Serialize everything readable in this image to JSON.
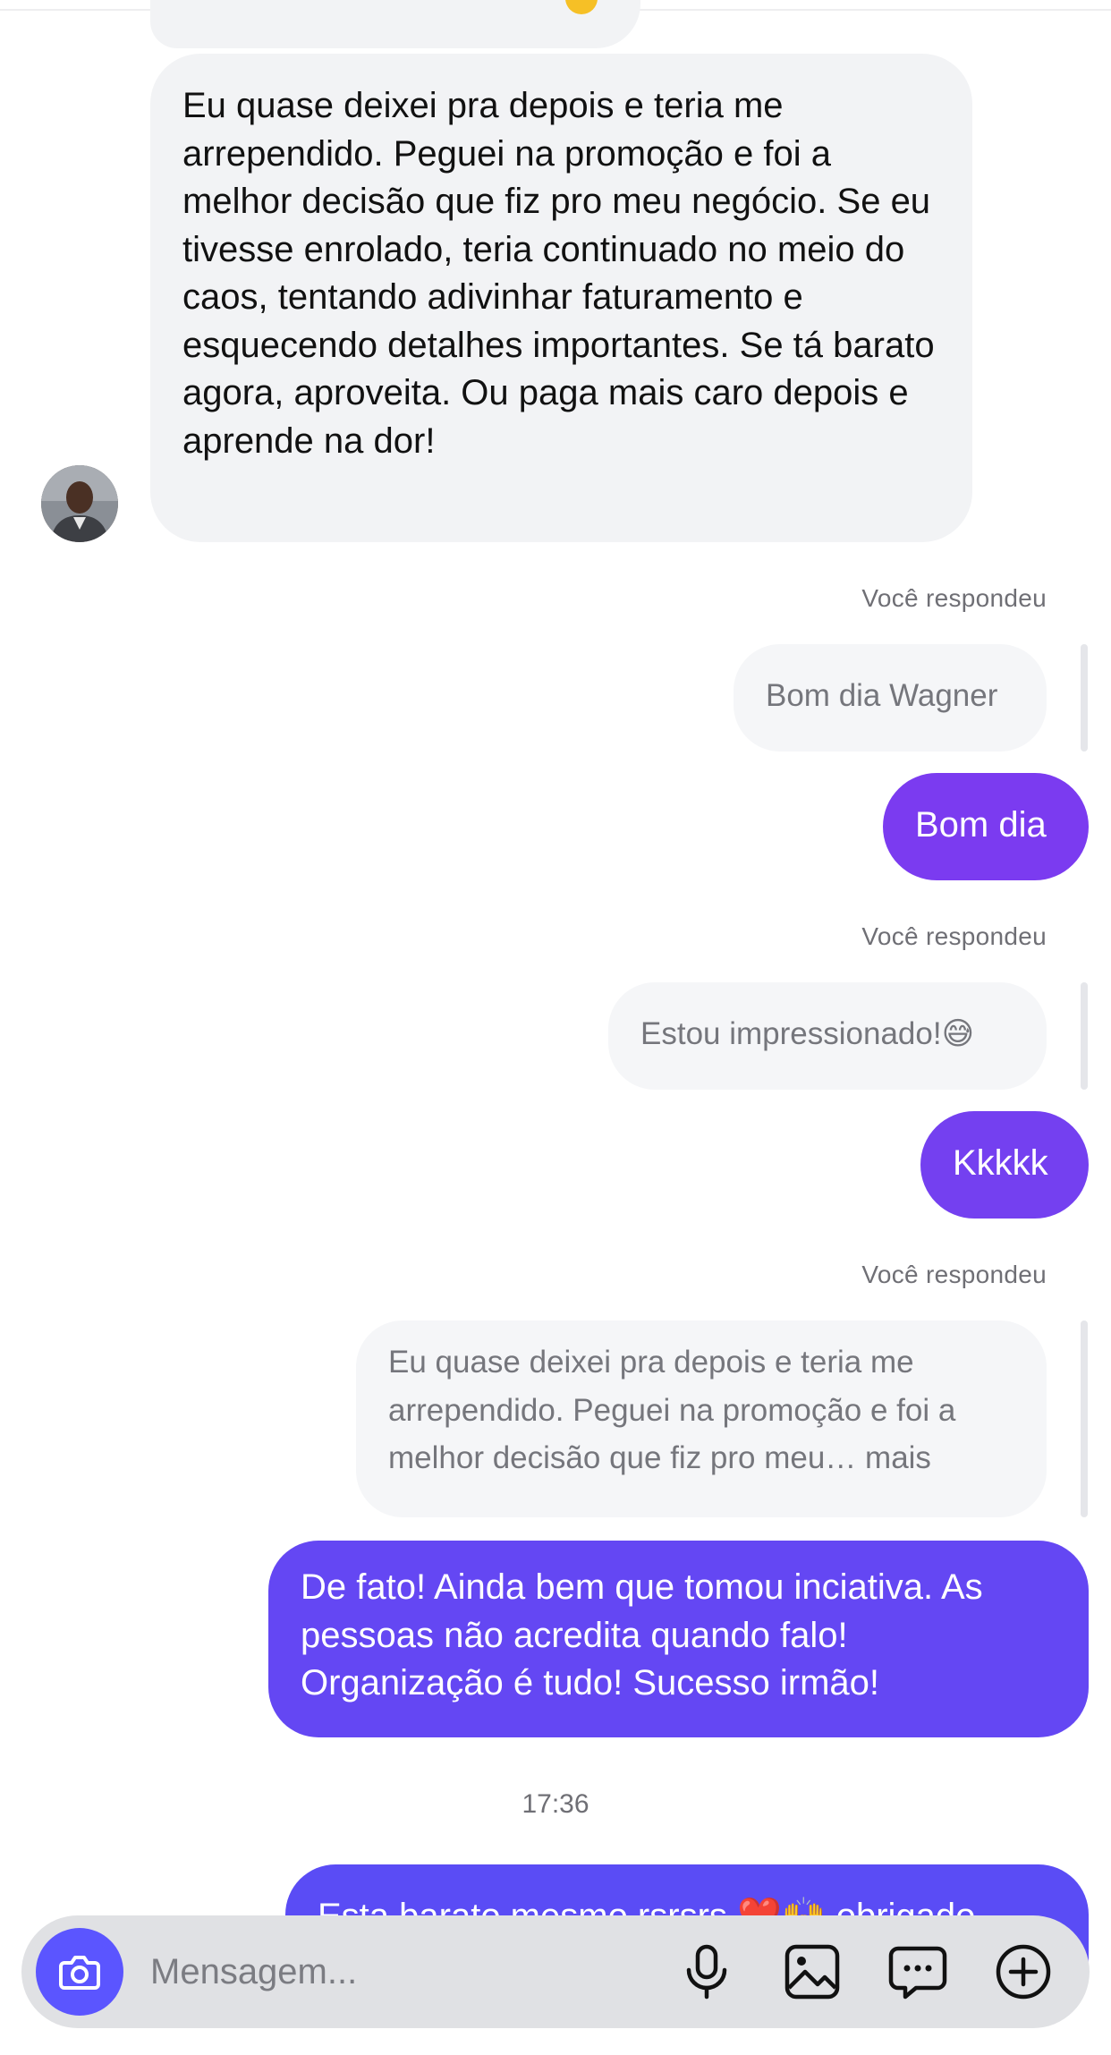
{
  "thread": {
    "incoming_message": "Eu quase deixei pra depois e teria me arrependido. Peguei na promoção e foi a melhor decisão que fiz pro meu negócio. Se eu tivesse enrolado, teria continuado no meio do caos, tentando adivinhar faturamento e esquecendo detalhes importantes. Se tá barato agora, aproveita. Ou paga mais caro depois e aprende na dor!",
    "replies": [
      {
        "label": "Você respondeu",
        "quoted": "Bom dia Wagner",
        "reply": "Bom dia"
      },
      {
        "label": "Você respondeu",
        "quoted": "Estou impressionado!😅",
        "reply": "Kkkkk"
      },
      {
        "label": "Você respondeu",
        "quoted": "Eu quase deixei pra depois e teria me arrependido. Peguei na promoção e foi a melhor decisão que fiz pro meu… mais",
        "reply": "De fato! Ainda bem que tomou inciativa. As pessoas não acredita quando falo! Organização é tudo! Sucesso irmão!"
      }
    ],
    "timestamp": "17:36",
    "last_outgoing_partial": "Esta barato mesmo rsrsrs ❤️🙌 obrigado"
  },
  "composer": {
    "placeholder": "Mensagem...",
    "icons": [
      "camera-icon",
      "microphone-icon",
      "image-icon",
      "sticker-icon",
      "plus-icon"
    ]
  },
  "colors": {
    "outgoing_top": "#7c3aed",
    "outgoing_bottom": "#5a4cf5",
    "incoming_bg": "#f2f3f5",
    "camera_button": "#5b55ff"
  }
}
